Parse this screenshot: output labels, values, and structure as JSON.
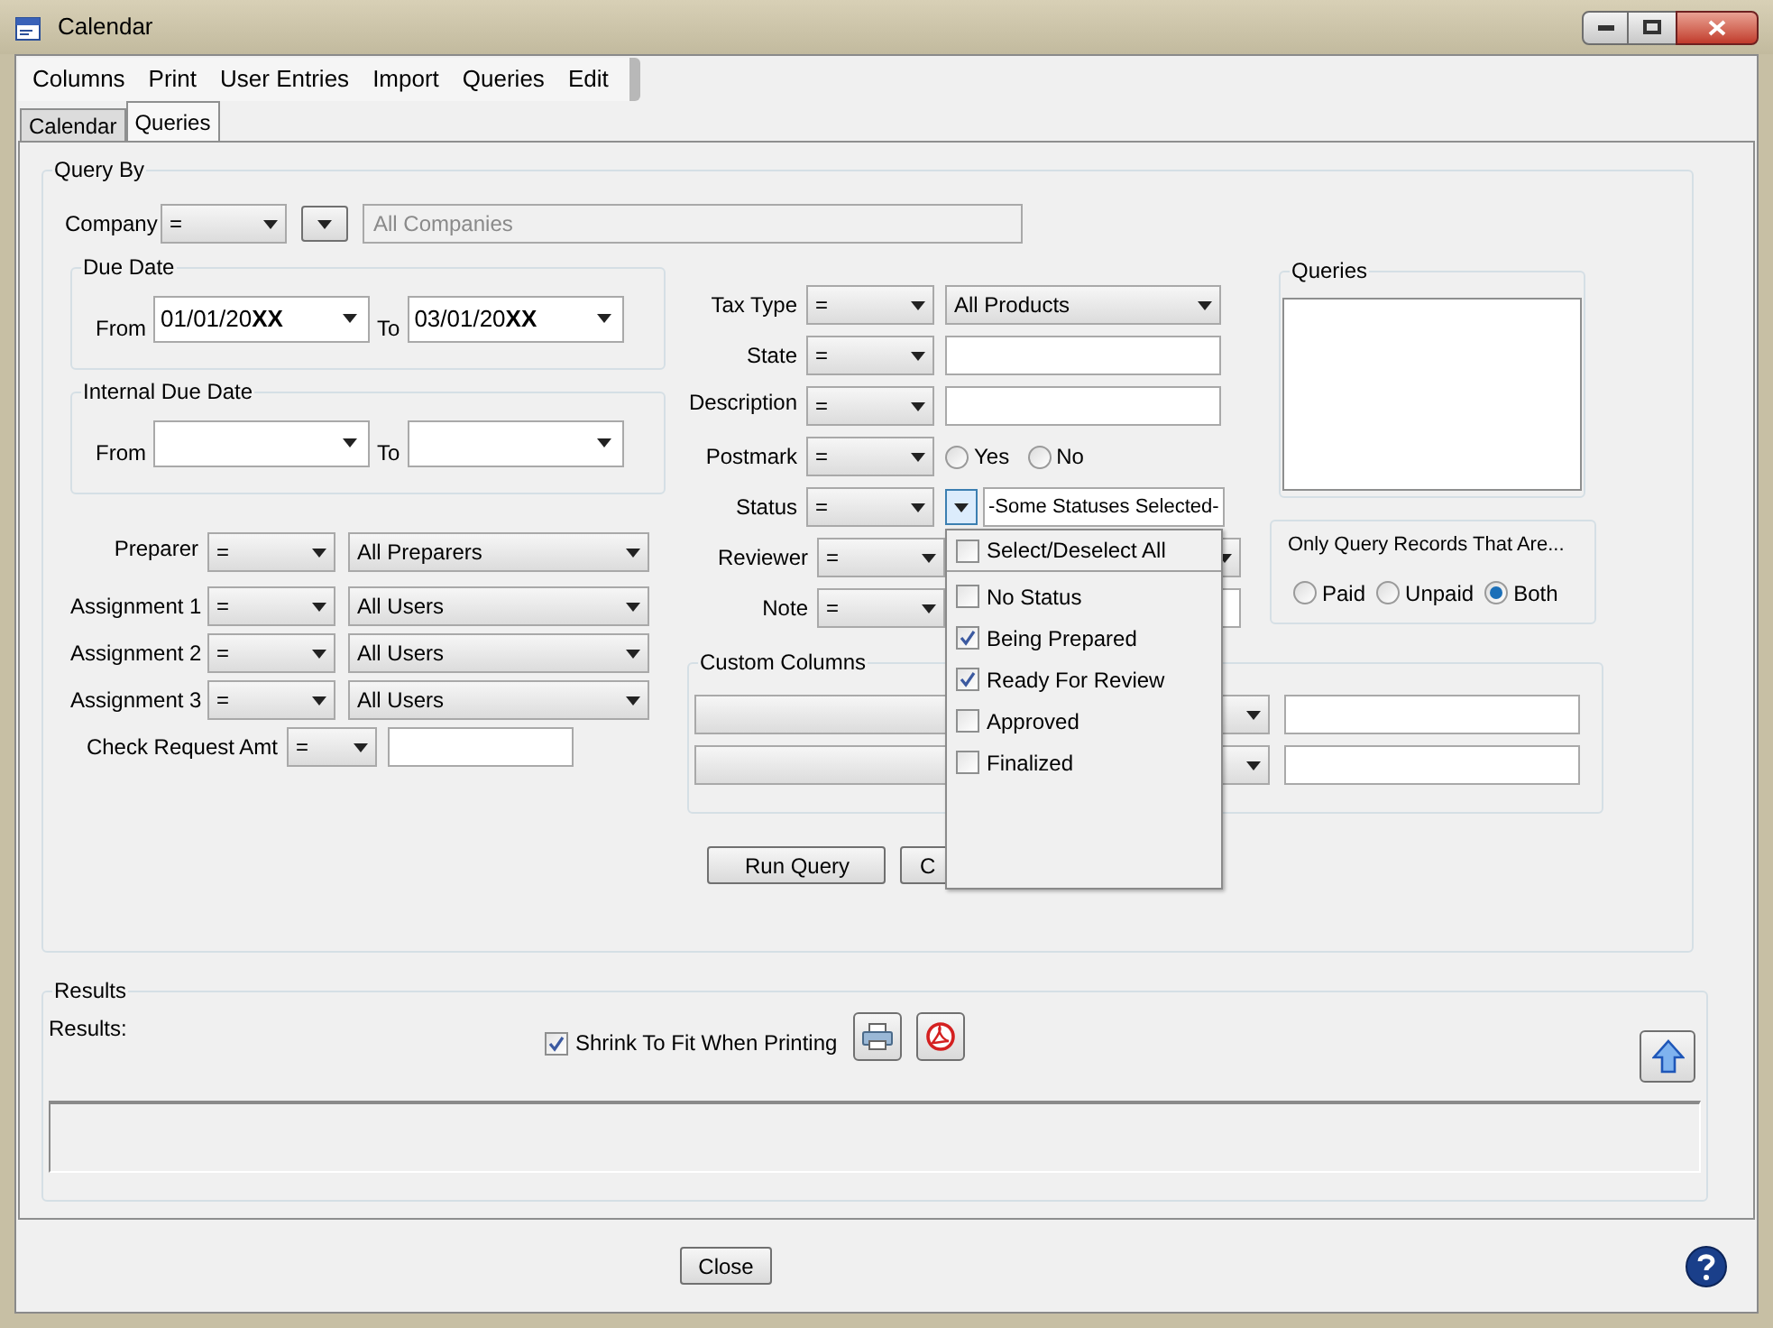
{
  "window": {
    "title": "Calendar"
  },
  "menu": [
    "Columns",
    "Print",
    "User Entries",
    "Import",
    "Queries",
    "Edit"
  ],
  "tabs": [
    {
      "label": "Calendar",
      "selected": false
    },
    {
      "label": "Queries",
      "selected": true
    }
  ],
  "query_by": {
    "title": "Query By",
    "company": {
      "label": "Company",
      "operator": "=",
      "placeholder": "All Companies"
    },
    "due_date": {
      "title": "Due Date",
      "from_label": "From",
      "from": "01/01/20**XX**",
      "to_label": "To",
      "to": "03/01/20**XX**"
    },
    "internal_due_date": {
      "title": "Internal Due Date",
      "from_label": "From",
      "to_label": "To"
    },
    "people": [
      {
        "label": "Preparer",
        "operator": "=",
        "value": "All Preparers"
      },
      {
        "label": "Assignment 1",
        "operator": "=",
        "value": "All Users"
      },
      {
        "label": "Assignment 2",
        "operator": "=",
        "value": "All Users"
      },
      {
        "label": "Assignment 3",
        "operator": "=",
        "value": "All Users"
      }
    ],
    "check_request": {
      "label": "Check Request Amt",
      "operator": "="
    },
    "filters": [
      {
        "kind": "select",
        "label": "Tax Type",
        "operator": "=",
        "value": "All Products"
      },
      {
        "kind": "text",
        "label": "State",
        "operator": "="
      },
      {
        "kind": "text",
        "label": "Description",
        "operator": "="
      },
      {
        "kind": "radio",
        "label": "Postmark",
        "operator": "=",
        "options": [
          {
            "label": "Yes",
            "selected": false
          },
          {
            "label": "No",
            "selected": false
          }
        ]
      },
      {
        "kind": "multi",
        "label": "Status",
        "operator": "=",
        "value": "-Some Statuses Selected-",
        "expanded": true
      },
      {
        "kind": "covered",
        "label": "Reviewer",
        "operator": "="
      },
      {
        "kind": "covered_text",
        "label": "Note",
        "operator": "="
      }
    ],
    "status_menu": {
      "select_all": {
        "label": "Select/Deselect All",
        "checked": false
      },
      "items": [
        {
          "label": "No Status",
          "checked": false
        },
        {
          "label": "Being Prepared",
          "checked": true
        },
        {
          "label": "Ready For Review",
          "checked": true
        },
        {
          "label": "Approved",
          "checked": false
        },
        {
          "label": "Finalized",
          "checked": false
        }
      ]
    },
    "queries": {
      "title": "Queries"
    },
    "record_filter": {
      "title": "Only Query Records That Are...",
      "options": [
        {
          "label": "Paid",
          "selected": false
        },
        {
          "label": "Unpaid",
          "selected": false
        },
        {
          "label": "Both",
          "selected": true
        }
      ]
    },
    "custom_columns": {
      "title": "Custom Columns"
    },
    "buttons": [
      "Run Query",
      "C"
    ]
  },
  "results": {
    "title": "Results",
    "label": "Results:",
    "shrink": {
      "label": "Shrink To Fit When Printing",
      "checked": true
    }
  },
  "close_button": "Close"
}
